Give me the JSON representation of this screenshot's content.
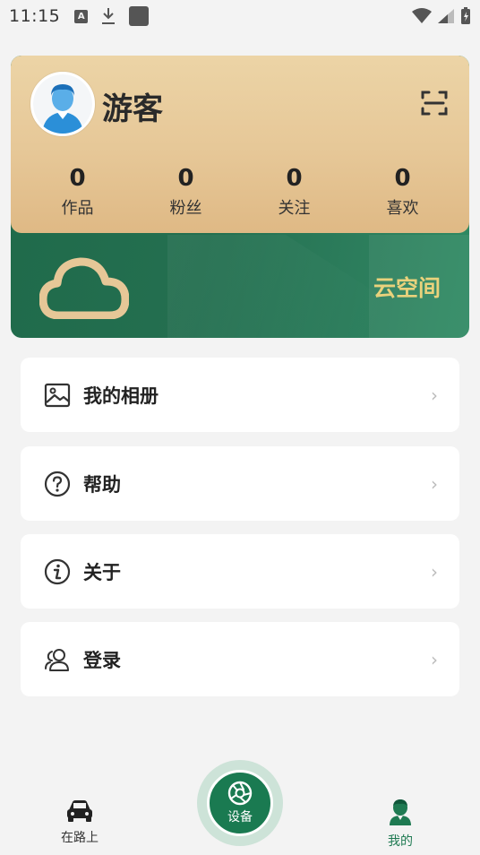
{
  "status_bar": {
    "time": "11:15",
    "icons": [
      "a-notification-icon",
      "download-icon",
      "stop-icon",
      "wifi-icon",
      "signal-icon",
      "battery-charging-icon"
    ],
    "a_badge": "A"
  },
  "profile": {
    "username": "游客",
    "avatar_icon": "user-avatar-icon",
    "scan_icon": "scan-icon",
    "stats": [
      {
        "value": "0",
        "label": "作品"
      },
      {
        "value": "0",
        "label": "粉丝"
      },
      {
        "value": "0",
        "label": "关注"
      },
      {
        "value": "0",
        "label": "喜欢"
      }
    ],
    "cloud_label": "云空间",
    "cloud_icon": "cloud-icon"
  },
  "menu": [
    {
      "label": "我的相册",
      "icon": "photo-album-icon"
    },
    {
      "label": "帮助",
      "icon": "help-icon"
    },
    {
      "label": "关于",
      "icon": "info-icon"
    },
    {
      "label": "登录",
      "icon": "login-users-icon"
    }
  ],
  "bottom_nav": {
    "left": {
      "label": "在路上",
      "icon": "car-icon"
    },
    "center": {
      "label": "设备",
      "icon": "aperture-icon"
    },
    "right": {
      "label": "我的",
      "icon": "profile-icon"
    }
  },
  "colors": {
    "accent_green": "#1a7a51",
    "gold_card": "#e6c797",
    "cloud_label": "#e9d27c",
    "background": "#f3f3f3"
  }
}
